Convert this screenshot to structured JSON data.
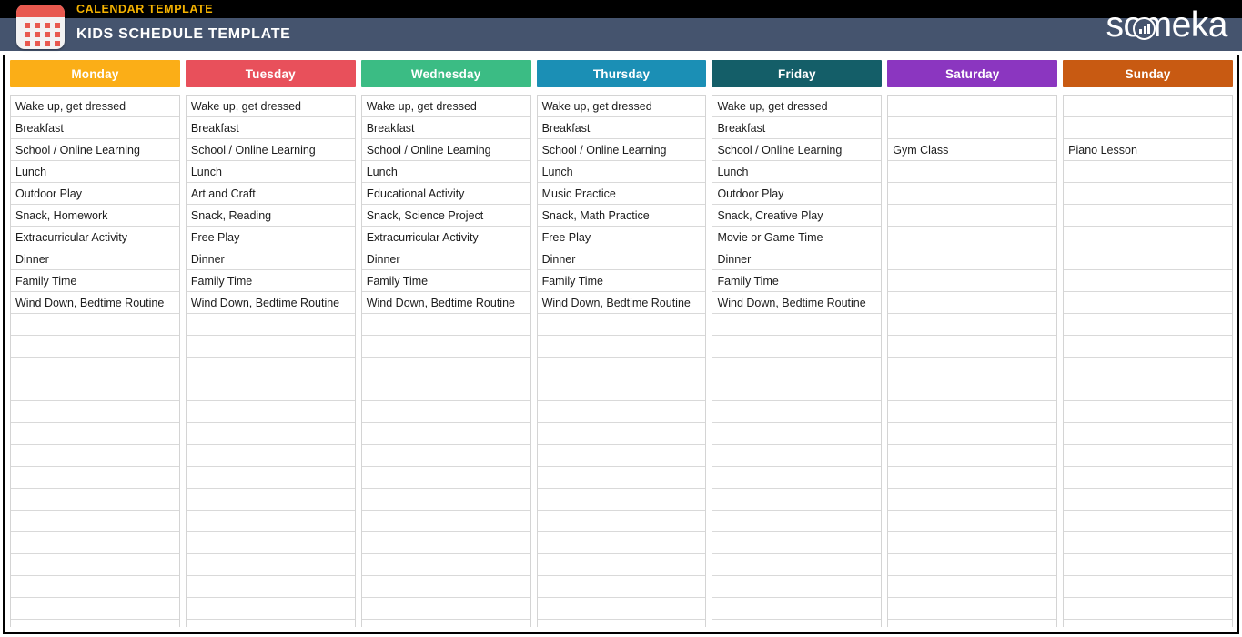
{
  "banner": {
    "subtitle": "CALENDAR TEMPLATE",
    "title": "KIDS SCHEDULE TEMPLATE",
    "logo_text": "someka",
    "icon": "calendar-icon",
    "colors": {
      "strip_black": "#000000",
      "strip_slate": "#45546E",
      "subtitle_yellow": "#F5B301",
      "icon_red": "#E8594F"
    }
  },
  "calendar": {
    "rows_total": 24,
    "columns": [
      {
        "day": "Monday",
        "color": "#FBAE17",
        "entries": [
          "Wake up, get dressed",
          "Breakfast",
          "School / Online Learning",
          "Lunch",
          "Outdoor Play",
          "Snack, Homework",
          "Extracurricular Activity",
          "Dinner",
          "Family Time",
          "Wind Down, Bedtime Routine"
        ]
      },
      {
        "day": "Tuesday",
        "color": "#E8505B",
        "entries": [
          "Wake up, get dressed",
          "Breakfast",
          "School / Online Learning",
          "Lunch",
          "Art and Craft",
          "Snack, Reading",
          "Free Play",
          "Dinner",
          "Family Time",
          "Wind Down, Bedtime Routine"
        ]
      },
      {
        "day": "Wednesday",
        "color": "#3BBC84",
        "entries": [
          "Wake up, get dressed",
          "Breakfast",
          "School / Online Learning",
          "Lunch",
          "Educational Activity",
          "Snack, Science Project",
          "Extracurricular Activity",
          "Dinner",
          "Family Time",
          "Wind Down, Bedtime Routine"
        ]
      },
      {
        "day": "Thursday",
        "color": "#1B8FB5",
        "entries": [
          "Wake up, get dressed",
          "Breakfast",
          "School / Online Learning",
          "Lunch",
          "Music Practice",
          "Snack, Math Practice",
          "Free Play",
          "Dinner",
          "Family Time",
          "Wind Down, Bedtime Routine"
        ]
      },
      {
        "day": "Friday",
        "color": "#145E68",
        "entries": [
          "Wake up, get dressed",
          "Breakfast",
          "School / Online Learning",
          "Lunch",
          "Outdoor Play",
          "Snack, Creative Play",
          "Movie or Game Time",
          "Dinner",
          "Family Time",
          "Wind Down, Bedtime Routine"
        ]
      },
      {
        "day": "Saturday",
        "color": "#8B36C0",
        "entries": [
          "",
          "",
          "Gym Class",
          "",
          "",
          "",
          "",
          "",
          "",
          ""
        ]
      },
      {
        "day": "Sunday",
        "color": "#C85A12",
        "entries": [
          "",
          "",
          "Piano Lesson",
          "",
          "",
          "",
          "",
          "",
          "",
          ""
        ]
      }
    ]
  }
}
